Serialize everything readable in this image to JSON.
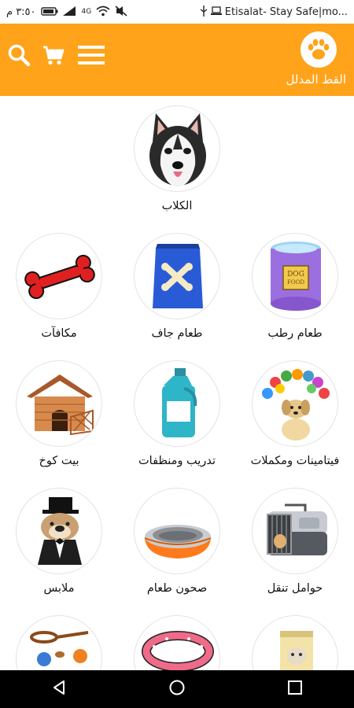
{
  "status_bar": {
    "carrier": "Etisalat- Stay Safe|mo...",
    "time": "٣:٥٠ م",
    "network": "4G"
  },
  "header": {
    "brand_name": "القط المدلل",
    "background": "#FFA31A",
    "icons": [
      "search-icon",
      "cart-icon",
      "menu-icon"
    ]
  },
  "categories": [
    {
      "label": "الكلاب",
      "icon": "husky-dog"
    },
    {
      "label": "طعام رطب",
      "icon": "wet-food-can"
    },
    {
      "label": "طعام جاف",
      "icon": "dry-food-bag"
    },
    {
      "label": "مكافآت",
      "icon": "bone"
    },
    {
      "label": "فيتامينات ومكملات",
      "icon": "vitamins-puppy"
    },
    {
      "label": "تدريب ومنظفات",
      "icon": "cleaner-bottle"
    },
    {
      "label": "بيت كوخ",
      "icon": "dog-house"
    },
    {
      "label": "حوامل تنقل",
      "icon": "pet-carrier"
    },
    {
      "label": "صحون طعام",
      "icon": "food-bowl"
    },
    {
      "label": "ملابس",
      "icon": "dressed-bulldog"
    }
  ],
  "nav": {
    "icons": [
      "back-icon",
      "home-icon",
      "recents-icon"
    ]
  }
}
